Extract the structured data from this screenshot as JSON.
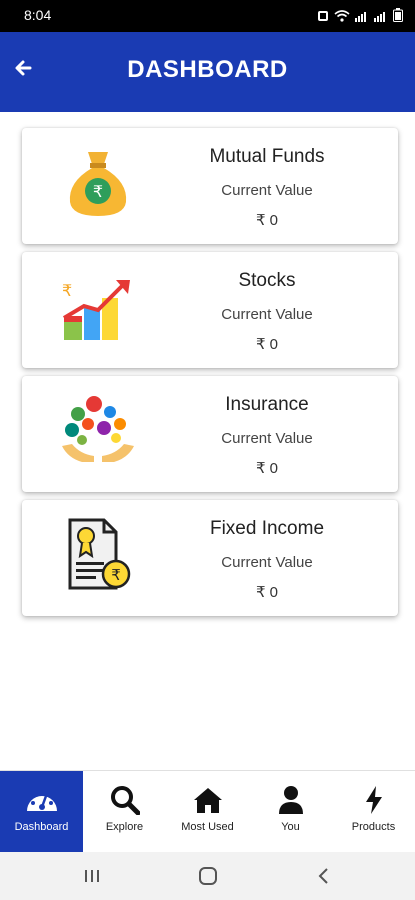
{
  "status_bar": {
    "time": "8:04"
  },
  "header": {
    "title": "DASHBOARD",
    "back_icon": "arrow-left-icon"
  },
  "cards": [
    {
      "title": "Mutual Funds",
      "subtitle": "Current Value",
      "value": "₹ 0",
      "icon": "money-bag-icon"
    },
    {
      "title": "Stocks",
      "subtitle": "Current Value",
      "value": "₹ 0",
      "icon": "growth-chart-icon"
    },
    {
      "title": "Insurance",
      "subtitle": "Current Value",
      "value": "₹ 0",
      "icon": "insurance-hands-icon"
    },
    {
      "title": "Fixed Income",
      "subtitle": "Current Value",
      "value": "₹ 0",
      "icon": "certificate-icon"
    }
  ],
  "bottom_nav": {
    "items": [
      {
        "label": "Dashboard",
        "icon": "speedometer-icon",
        "active": true
      },
      {
        "label": "Explore",
        "icon": "search-icon",
        "active": false
      },
      {
        "label": "Most Used",
        "icon": "home-icon",
        "active": false
      },
      {
        "label": "You",
        "icon": "person-icon",
        "active": false
      },
      {
        "label": "Products",
        "icon": "lightning-icon",
        "active": false
      }
    ]
  },
  "colors": {
    "primary": "#1a3bb3",
    "status_bar": "#000000",
    "background": "#ffffff"
  }
}
